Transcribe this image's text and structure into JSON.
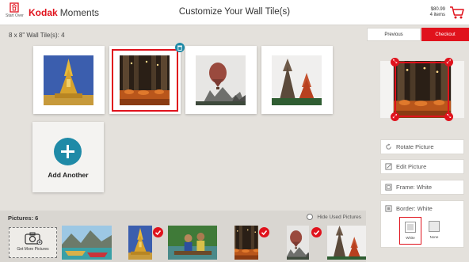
{
  "header": {
    "start_over_label": "Start Over",
    "brand_name": "Kodak",
    "brand_suffix": "Moments",
    "page_title": "Customize Your Wall Tile(s)",
    "cart_price": "$80.99",
    "cart_items": "4 items"
  },
  "tiles": {
    "count_label": "8 x 8\" Wall Tile(s):  4",
    "add_label": "Add Another",
    "selected_index": 1
  },
  "nav": {
    "previous_label": "Previous",
    "checkout_label": "Checkout"
  },
  "options": {
    "rotate_label": "Rotate Picture",
    "edit_label": "Edit Picture",
    "frame_label": "Frame: White",
    "border_label": "Border: White",
    "border_choices": [
      {
        "label": "White",
        "selected": true
      },
      {
        "label": "None",
        "selected": false
      }
    ]
  },
  "pictures": {
    "label": "Pictures: 6",
    "hide_used_label": "Hide Used Pictures",
    "get_more_label": "Get More Pictures"
  },
  "colors": {
    "accent": "#e0121c",
    "teal": "#1f8aa7",
    "background": "#e4e1dc"
  },
  "icons": [
    "start-over-icon",
    "cart-icon",
    "rotate-icon",
    "edit-icon",
    "frame-icon",
    "border-icon",
    "camera-icon",
    "check-icon",
    "resize-handle-icon",
    "plus-icon"
  ]
}
